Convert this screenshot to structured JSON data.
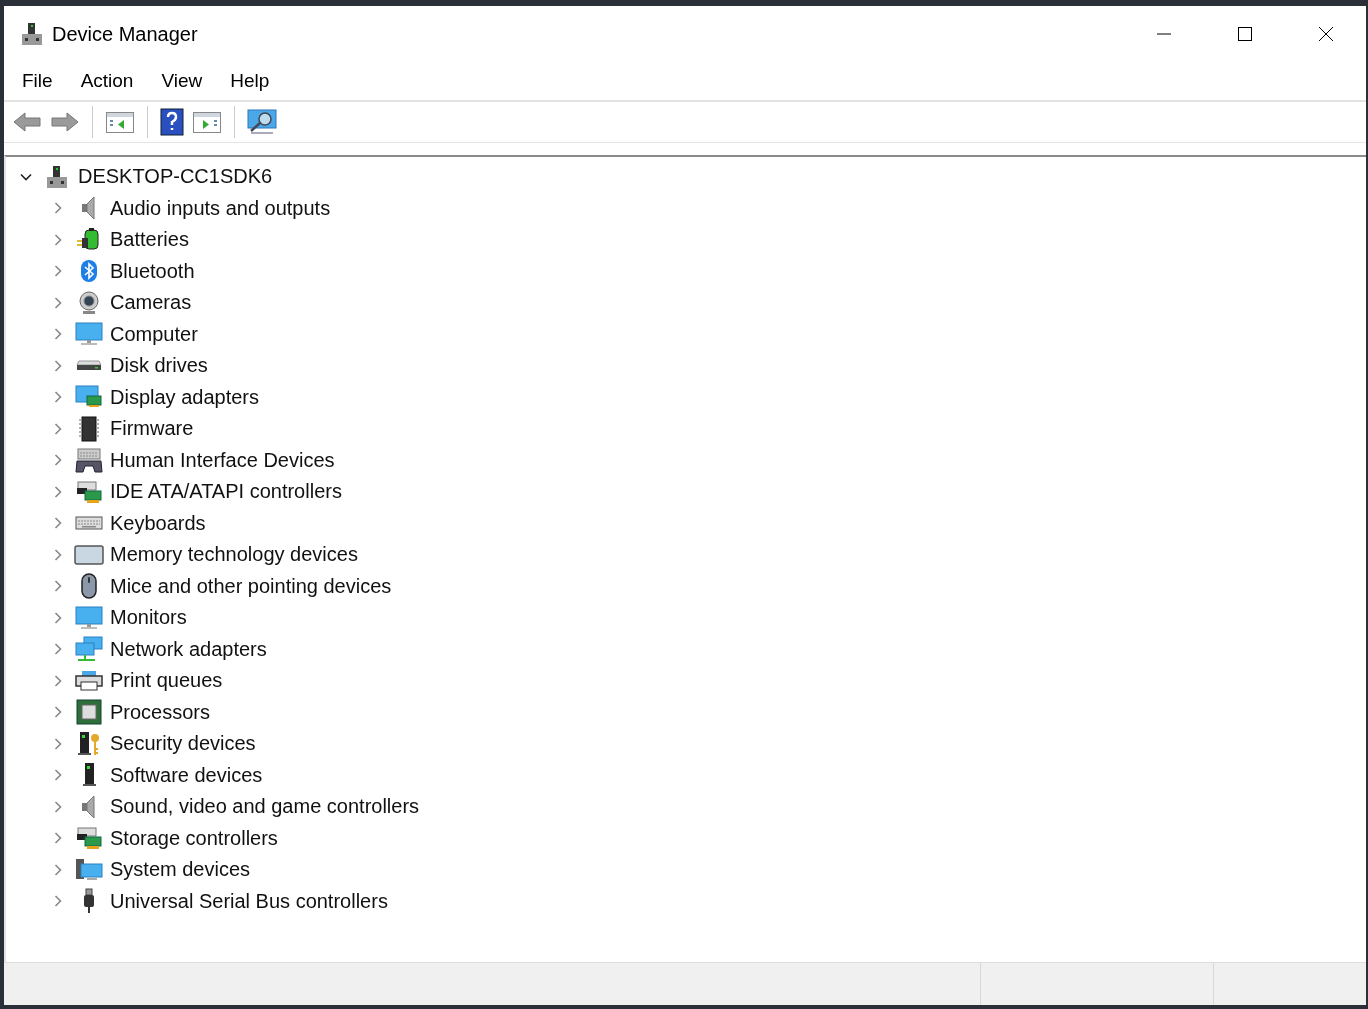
{
  "window": {
    "title": "Device Manager"
  },
  "menu": [
    "File",
    "Action",
    "View",
    "Help"
  ],
  "tree": {
    "label": "DESKTOP-CC1SDK6",
    "expanded": true,
    "children": [
      {
        "label": "Audio inputs and outputs",
        "expanded": false
      },
      {
        "label": "Batteries",
        "expanded": false
      },
      {
        "label": "Bluetooth",
        "expanded": false
      },
      {
        "label": "Cameras",
        "expanded": false
      },
      {
        "label": "Computer",
        "expanded": false
      },
      {
        "label": "Disk drives",
        "expanded": false
      },
      {
        "label": "Display adapters",
        "expanded": false
      },
      {
        "label": "Firmware",
        "expanded": false
      },
      {
        "label": "Human Interface Devices",
        "expanded": false
      },
      {
        "label": "IDE ATA/ATAPI controllers",
        "expanded": false
      },
      {
        "label": "Keyboards",
        "expanded": false
      },
      {
        "label": "Memory technology devices",
        "expanded": false
      },
      {
        "label": "Mice and other pointing devices",
        "expanded": false
      },
      {
        "label": "Monitors",
        "expanded": false
      },
      {
        "label": "Network adapters",
        "expanded": false
      },
      {
        "label": "Print queues",
        "expanded": false
      },
      {
        "label": "Processors",
        "expanded": false
      },
      {
        "label": "Security devices",
        "expanded": false
      },
      {
        "label": "Software devices",
        "expanded": false
      },
      {
        "label": "Sound, video and game controllers",
        "expanded": false
      },
      {
        "label": "Storage controllers",
        "expanded": false
      },
      {
        "label": "System devices",
        "expanded": false
      },
      {
        "label": "Universal Serial Bus controllers",
        "expanded": false
      }
    ]
  }
}
